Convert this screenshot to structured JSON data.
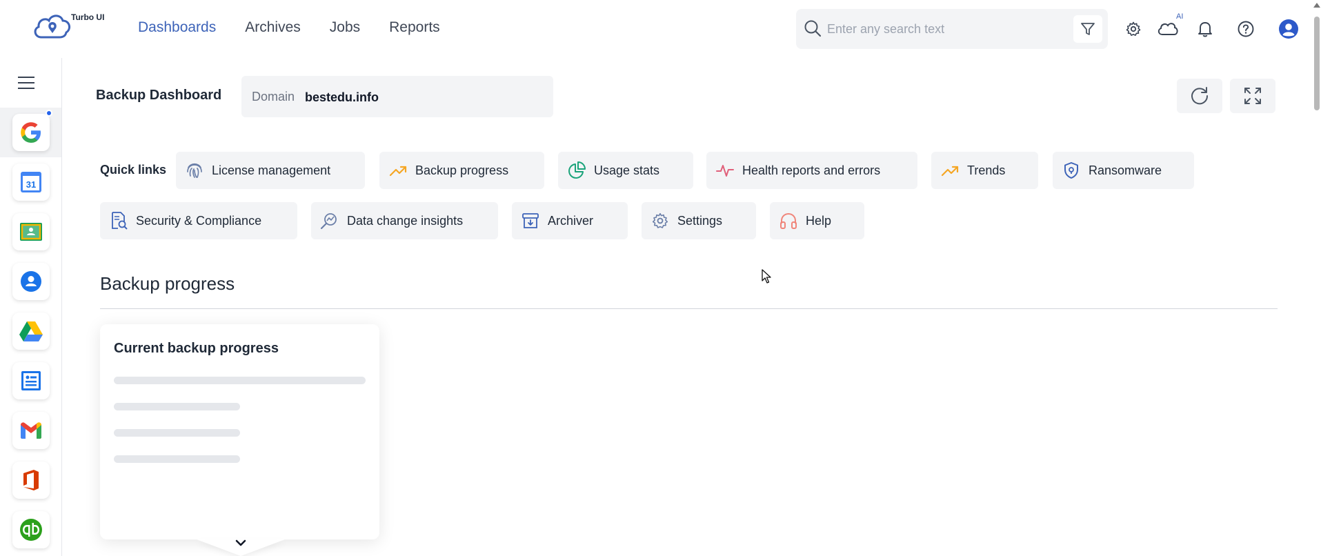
{
  "app": {
    "logo_text": "Turbo UI"
  },
  "nav": {
    "items": [
      {
        "label": "Dashboards",
        "active": true
      },
      {
        "label": "Archives",
        "active": false
      },
      {
        "label": "Jobs",
        "active": false
      },
      {
        "label": "Reports",
        "active": false
      }
    ]
  },
  "search": {
    "placeholder": "Enter any search text",
    "value": ""
  },
  "header_icons": {
    "ai_badge": "AI",
    "icons": [
      "gear-icon",
      "cloud-ai-icon",
      "bell-icon",
      "help-icon",
      "user-avatar-icon"
    ]
  },
  "rail": {
    "apps": [
      "google",
      "google-calendar",
      "google-classroom",
      "google-contacts",
      "google-drive",
      "google-directory",
      "gmail",
      "office",
      "quickbooks"
    ],
    "calendar_day": "31"
  },
  "page": {
    "title": "Backup Dashboard",
    "domain_label": "Domain",
    "domain_value": "bestedu.info"
  },
  "quick_links": {
    "label": "Quick links",
    "items": [
      {
        "label": "License management",
        "icon": "fingerprint-icon"
      },
      {
        "label": "Backup progress",
        "icon": "trend-up-icon"
      },
      {
        "label": "Usage stats",
        "icon": "pie-chart-icon"
      },
      {
        "label": "Health reports and errors",
        "icon": "pulse-icon"
      },
      {
        "label": "Trends",
        "icon": "trend-up-icon"
      },
      {
        "label": "Ransomware",
        "icon": "shield-icon"
      },
      {
        "label": "Security & Compliance",
        "icon": "document-search-icon"
      },
      {
        "label": "Data change insights",
        "icon": "analytics-search-icon"
      },
      {
        "label": "Archiver",
        "icon": "archive-box-icon"
      },
      {
        "label": "Settings",
        "icon": "gear-icon"
      },
      {
        "label": "Help",
        "icon": "headset-icon"
      }
    ]
  },
  "section": {
    "title": "Backup progress",
    "card_title": "Current backup progress"
  },
  "colors": {
    "accent": "#3d63b8",
    "chip_bg": "#f3f4f6"
  }
}
